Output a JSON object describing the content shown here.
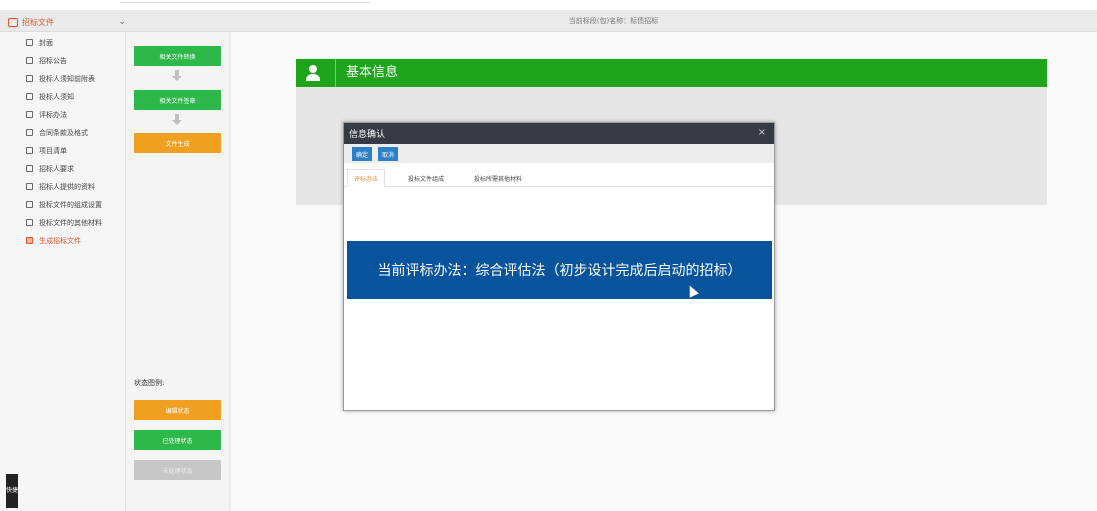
{
  "header": {
    "doc_select_label": "招标文件",
    "tender_name": "当前标段(包)名称：标债招标"
  },
  "sidebar": {
    "items": [
      {
        "label": "封面"
      },
      {
        "label": "招标公告"
      },
      {
        "label": "投标人须知前附表"
      },
      {
        "label": "投标人须知"
      },
      {
        "label": "评标办法"
      },
      {
        "label": "合同条款及格式"
      },
      {
        "label": "项目清单"
      },
      {
        "label": "招标人要求"
      },
      {
        "label": "招标人提供的资料"
      },
      {
        "label": "投标文件的组成设置"
      },
      {
        "label": "投标文件的其他材料"
      },
      {
        "label": "生成招标文件"
      }
    ]
  },
  "flow": {
    "step1": "相关文件转换",
    "step2": "相关文件签章",
    "step3": "文件生成",
    "legend_title": "状态图例:",
    "legend_edit": "编辑状态",
    "legend_done": "已处理状态",
    "legend_pending": "未处理状态"
  },
  "main": {
    "section_title": "基本信息"
  },
  "modal": {
    "title": "信息确认",
    "close": "×",
    "ok_label": "确定",
    "cancel_label": "取消",
    "tabs": [
      {
        "label": "评标办法"
      },
      {
        "label": "投标文件组成"
      },
      {
        "label": "投标所需其他材料"
      }
    ],
    "banner_text": "当前评标办法：综合评估法（初步设计完成后启动的招标）"
  },
  "quick": {
    "label": "快捷"
  },
  "colors": {
    "green": "#2eb84a",
    "orange": "#f0a021",
    "banner_blue": "#07549d",
    "active_orange": "#e4572e"
  }
}
